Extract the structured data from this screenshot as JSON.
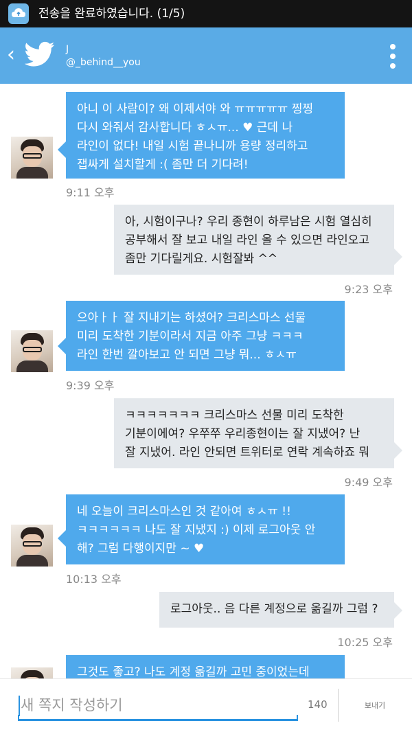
{
  "status_bar": {
    "notification_text": "전송을 완료하였습니다. (1/5)",
    "icon": "cloud-upload-icon"
  },
  "header": {
    "name": "J",
    "handle": "@_behind__you",
    "accent_color": "#5aabe6",
    "icons": [
      "back-icon",
      "twitter-bird-icon",
      "overflow-menu-icon"
    ]
  },
  "messages": [
    {
      "direction": "in",
      "text": "아니 이 사람이? 왜 이제서야 와 ㅠㅠㅠㅠㅠ 찡찡\n다시 와줘서 감사합니다 ㅎㅅㅠ... ♥ 근데 나\n라인이 없다! 내일 시험 끝나니까 용량 정리하고\n잽싸게 설치할게 :( 좀만 더 기다려!",
      "time": "9:11 오후"
    },
    {
      "direction": "out",
      "text": "아, 시험이구나? 우리 종현이 하루남은 시험 열심히\n공부해서 잘 보고 내일 라인 올 수 있으면 라인오고\n좀만 기다릴게요. 시험잘봐 ^^",
      "time": "9:23 오후"
    },
    {
      "direction": "in",
      "text": "으아ㅏㅏ 잘 지내기는 하셨어? 크리스마스 선물\n미리 도착한 기분이라서 지금 아주 그냥 ㅋㅋㅋ\n라인 한번 깔아보고 안 되면 그냥 뭐... ㅎㅅㅠ",
      "time": "9:39 오후"
    },
    {
      "direction": "out",
      "text": "ㅋㅋㅋㅋㅋㅋㅋ 크리스마스 선물 미리 도착한\n기분이에여? 우쭈쭈 우리종현이는 잘 지냈어?  난\n잘 지냈어. 라인 안되면 트위터로 연락 계속하죠 뭐",
      "time": "9:49 오후"
    },
    {
      "direction": "in",
      "text": "네 오늘이 크리스마스인 것 같아여 ㅎㅅㅠ !!\nㅋㅋㅋㅋㅋㅋ 나도 잘 지냈지 :) 이제 로그아웃 안\n해? 그럼 다행이지만 ~ ♥",
      "time": "10:13 오후"
    },
    {
      "direction": "out",
      "text": "로그아웃.. 음 다른 계정으로 옮길까 그럼 ?",
      "time": "10:25 오후"
    },
    {
      "direction": "in",
      "text": "그것도 좋고? 나도 계정 옮길까 고민 중이었는데",
      "time": ""
    }
  ],
  "composer": {
    "placeholder": "새 쪽지 작성하기",
    "char_count": "140",
    "send_label": "보내기",
    "focus_color": "#2a93e0"
  },
  "colors": {
    "incoming_bubble": "#4fa9ec",
    "outgoing_bubble": "#e4e8ec",
    "timestamp": "#888888"
  }
}
